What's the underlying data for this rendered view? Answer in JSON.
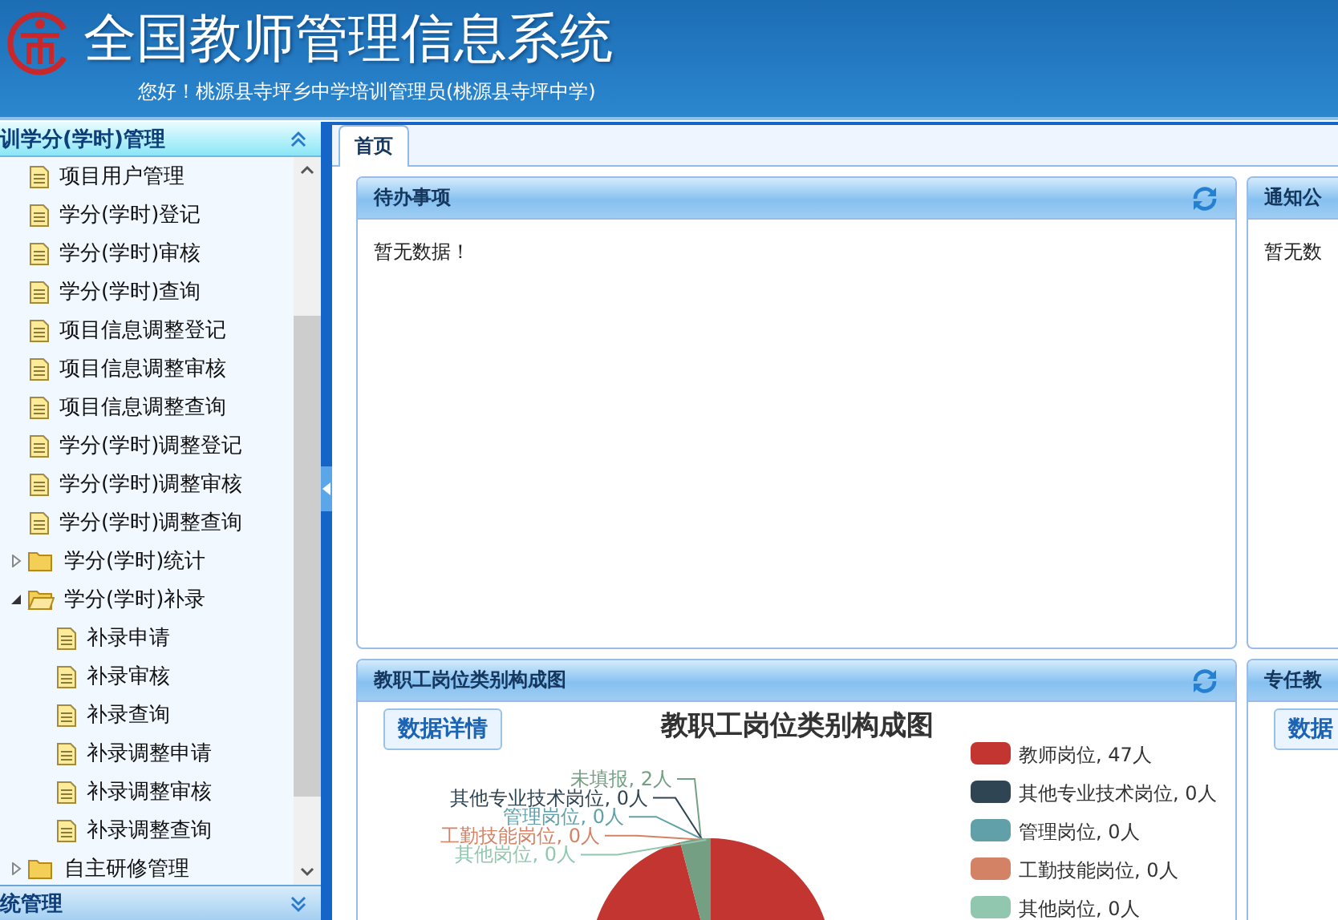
{
  "header": {
    "title": "全国教师管理信息系统",
    "greeting": "您好！桃源县寺坪乡中学培训管理员(桃源县寺坪中学)"
  },
  "sidebar": {
    "sections": [
      {
        "title": "训学分(学时)管理",
        "expanded": true,
        "items": [
          {
            "label": "项目用户管理",
            "kind": "page"
          },
          {
            "label": "学分(学时)登记",
            "kind": "page"
          },
          {
            "label": "学分(学时)审核",
            "kind": "page"
          },
          {
            "label": "学分(学时)查询",
            "kind": "page"
          },
          {
            "label": "项目信息调整登记",
            "kind": "page"
          },
          {
            "label": "项目信息调整审核",
            "kind": "page"
          },
          {
            "label": "项目信息调整查询",
            "kind": "page"
          },
          {
            "label": "学分(学时)调整登记",
            "kind": "page"
          },
          {
            "label": "学分(学时)调整审核",
            "kind": "page"
          },
          {
            "label": "学分(学时)调整查询",
            "kind": "page"
          },
          {
            "label": "学分(学时)统计",
            "kind": "folder",
            "expanded": false
          },
          {
            "label": "学分(学时)补录",
            "kind": "folder",
            "expanded": true,
            "children": [
              {
                "label": "补录申请",
                "kind": "page"
              },
              {
                "label": "补录审核",
                "kind": "page"
              },
              {
                "label": "补录查询",
                "kind": "page"
              },
              {
                "label": "补录调整申请",
                "kind": "page"
              },
              {
                "label": "补录调整审核",
                "kind": "page"
              },
              {
                "label": "补录调整查询",
                "kind": "page"
              }
            ]
          },
          {
            "label": "自主研修管理",
            "kind": "folder",
            "expanded": false
          }
        ]
      },
      {
        "title": "统管理",
        "expanded": false
      }
    ]
  },
  "tabs": [
    {
      "label": "首页",
      "selected": true
    }
  ],
  "panels": [
    {
      "title": "待办事项",
      "kind": "message",
      "message": "暂无数据！"
    },
    {
      "title": "通知公",
      "kind": "message",
      "message": "暂无数"
    },
    {
      "title": "教职工岗位类别构成图",
      "kind": "chart",
      "button": "数据详情",
      "chart_data": {
        "type": "pie",
        "title": "教职工岗位类别构成图",
        "categories": [
          "教师岗位, 47人",
          "其他专业技术岗位, 0人",
          "管理岗位, 0人",
          "工勤技能岗位, 0人",
          "其他岗位, 0人",
          "未填报, 2人"
        ],
        "values": [
          47,
          0,
          0,
          0,
          0,
          2
        ],
        "colors": [
          "#c23531",
          "#2f4554",
          "#61a0a8",
          "#d48265",
          "#91c7ae",
          "#749f83"
        ]
      }
    },
    {
      "title": "专任教",
      "kind": "chart",
      "button": "数据"
    }
  ]
}
